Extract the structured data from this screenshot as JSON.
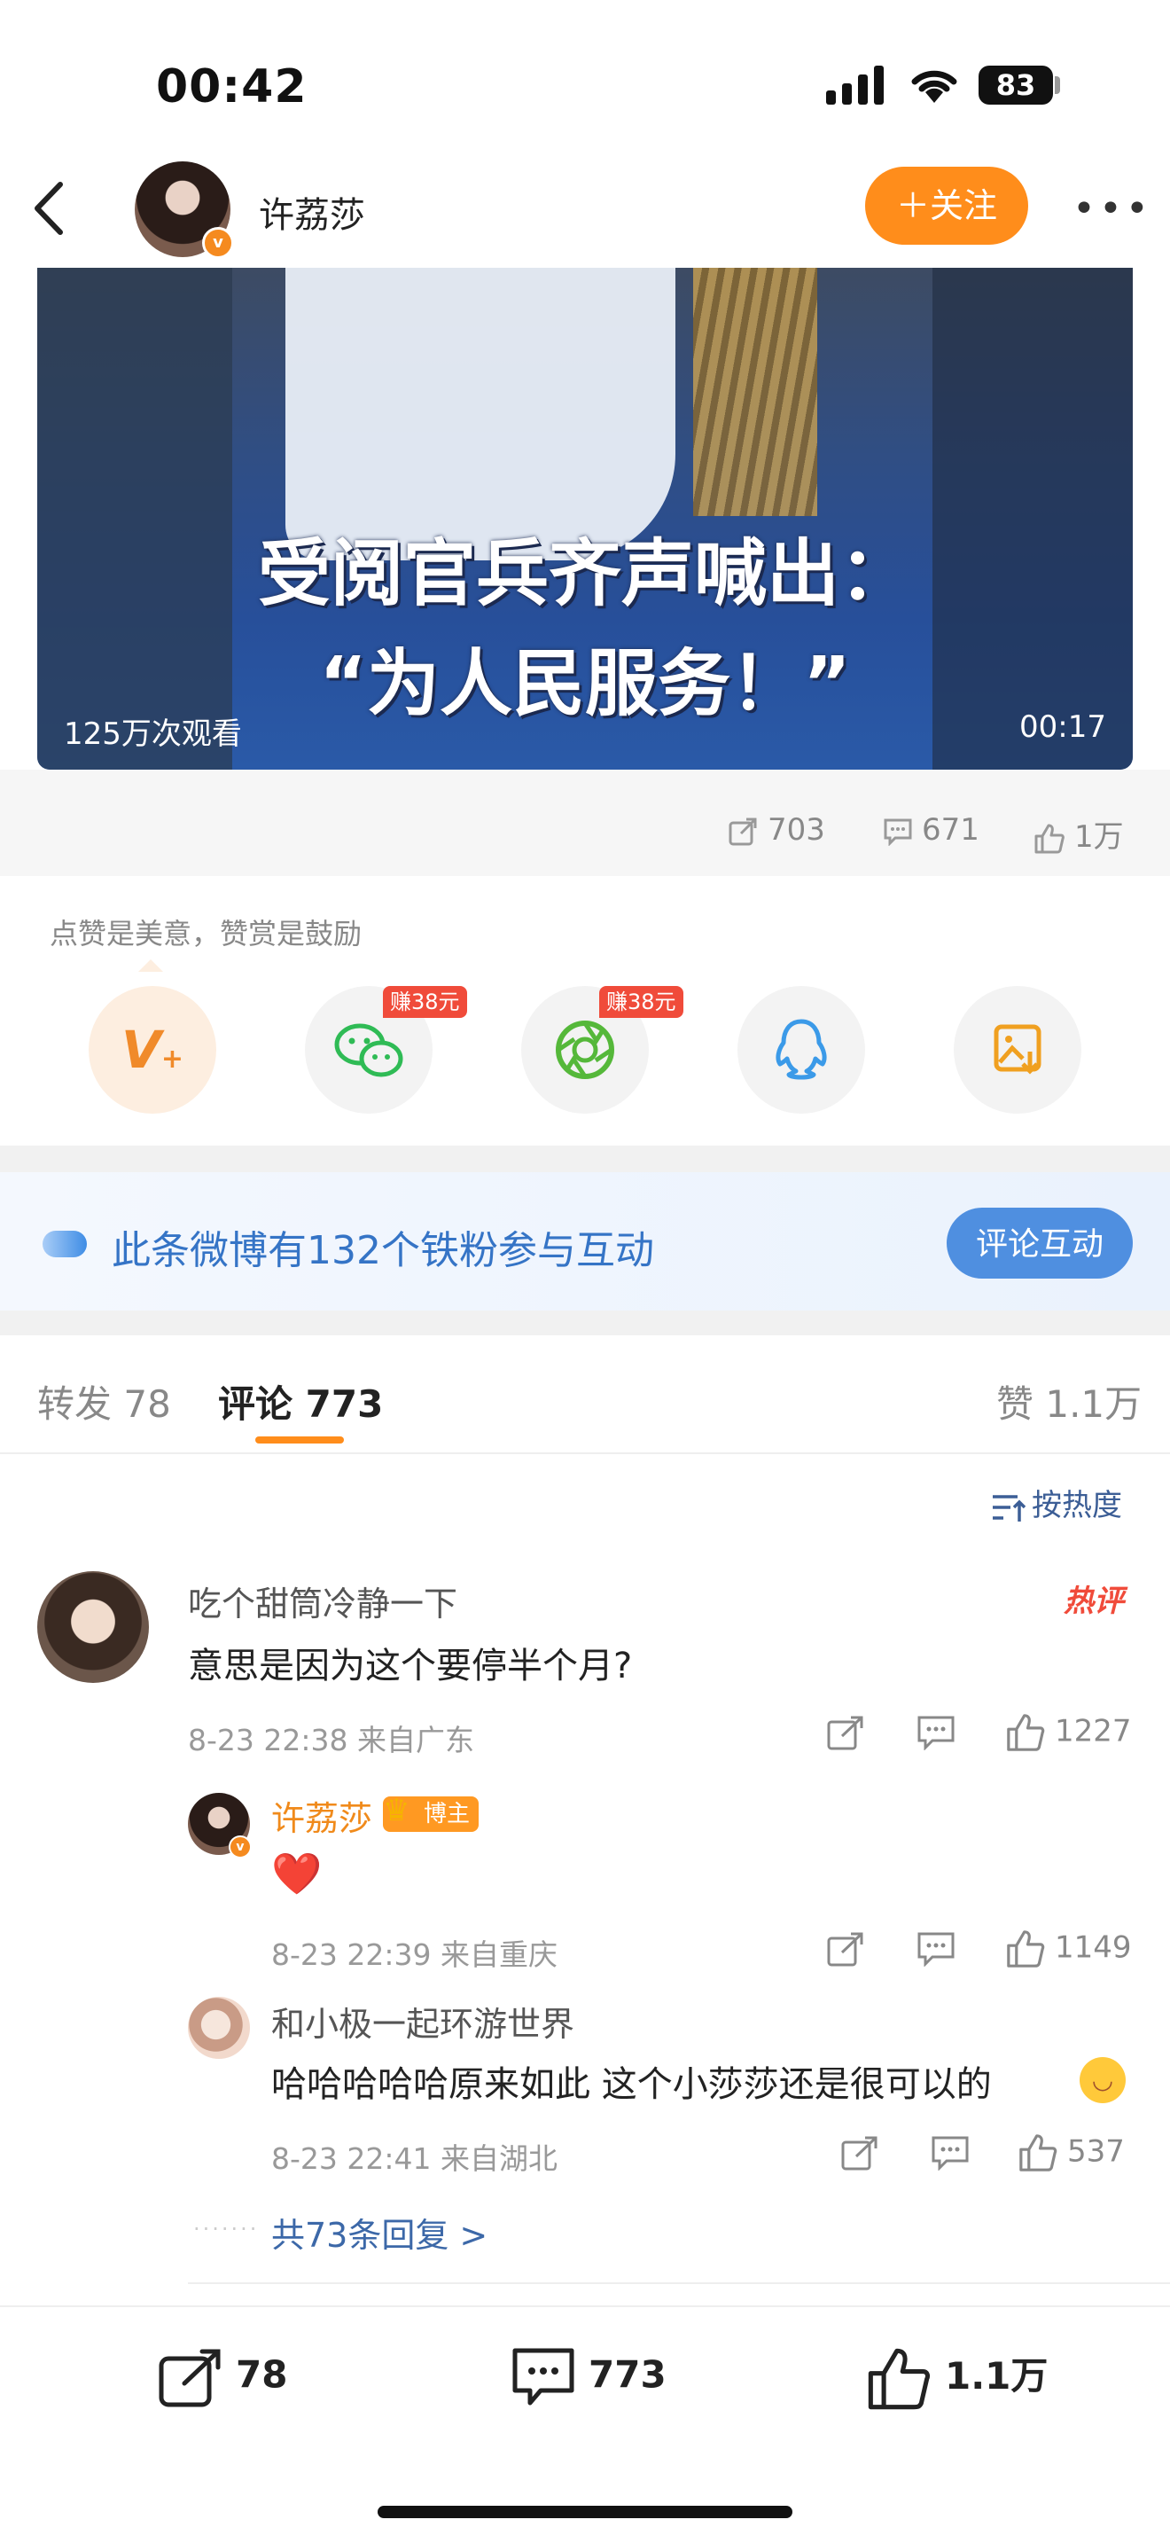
{
  "status_bar": {
    "time": "00:42",
    "battery": "83"
  },
  "header": {
    "author_name": "许荔莎",
    "follow_label": "＋关注",
    "more_label": "•••"
  },
  "video": {
    "caption_line1": "受阅官兵齐声喊出：",
    "caption_line2": "“为人民服务！”",
    "views": "125万次观看",
    "duration": "00:17"
  },
  "post_stats": {
    "reposts": "703",
    "comments": "671",
    "likes": "1万"
  },
  "reward": {
    "tip": "点赞是美意，赞赏是鼓励",
    "earn_tag": "赚38元",
    "share_targets": [
      {
        "name": "vplus-reward",
        "icon": "V+"
      },
      {
        "name": "wechat",
        "icon": "wechat-icon"
      },
      {
        "name": "moments",
        "icon": "moments-icon"
      },
      {
        "name": "qq",
        "icon": "qq-icon"
      },
      {
        "name": "save-image",
        "icon": "save-image-icon"
      }
    ]
  },
  "fans_banner": {
    "text": "此条微博有132个铁粉参与互动",
    "button": "评论互动"
  },
  "tabs": {
    "repost": "转发 78",
    "comment": "评论 773",
    "like": "赞 1.1万",
    "sort": "按热度"
  },
  "comments": [
    {
      "user": "吃个甜筒冷静一下",
      "text": "意思是因为这个要停半个月?",
      "meta": "8-23 22:38  来自广东",
      "likes": "1227",
      "hot_tag": "热评",
      "replies": [
        {
          "user": "许荔莎",
          "badge": "博主",
          "text": "❤️",
          "meta": "8-23 22:39  来自重庆",
          "likes": "1149"
        },
        {
          "user": "和小极一起环游世界",
          "text": "哈哈哈哈哈原来如此 这个小莎莎还是很可以的",
          "meta": "8-23 22:41  来自湖北",
          "likes": "537"
        }
      ],
      "more_replies": "共73条回复 >"
    }
  ],
  "bottom_bar": {
    "reposts": "78",
    "comments": "773",
    "likes": "1.1万"
  },
  "colors": {
    "accent": "#ff8d1b",
    "link": "#3c68a8",
    "banner_text": "#3574c6",
    "hot": "#f04b3a"
  }
}
